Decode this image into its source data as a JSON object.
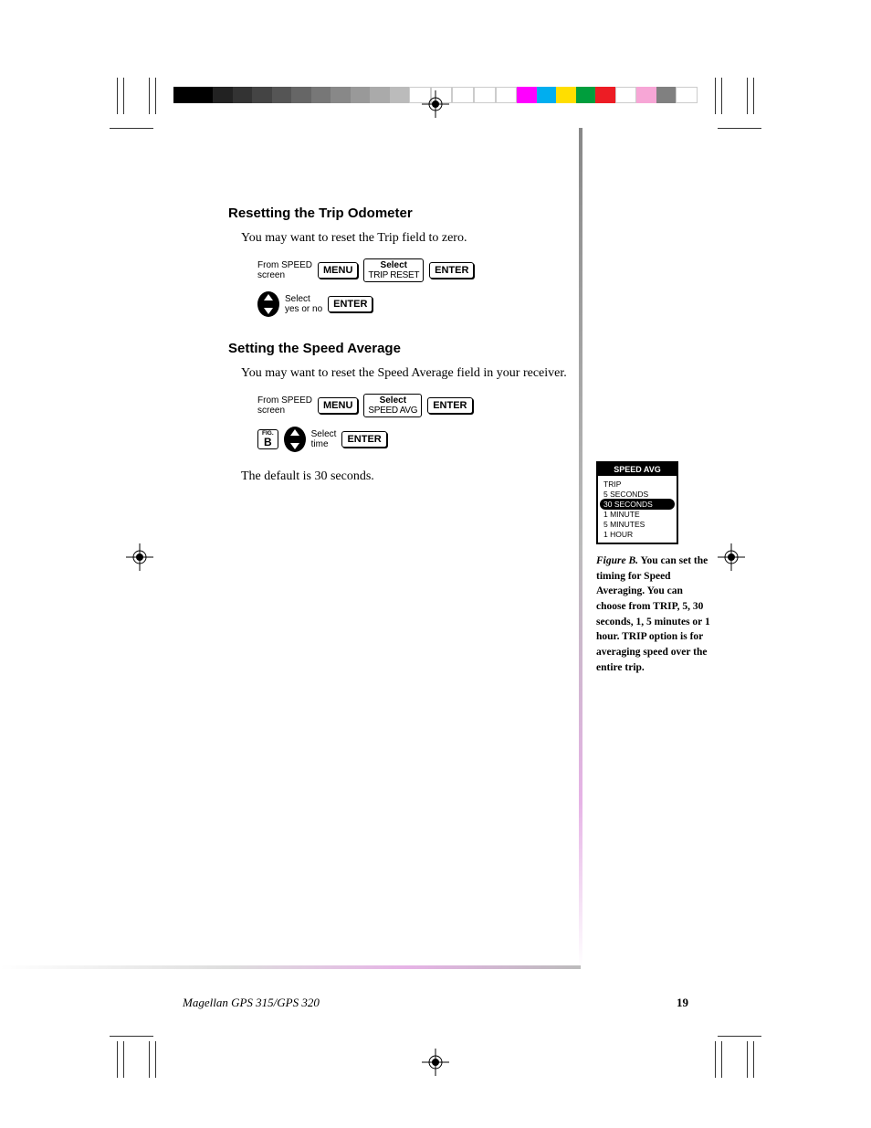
{
  "section1": {
    "heading": "Resetting the Trip Odometer",
    "body": "You may want to reset the Trip field to zero.",
    "seq1": {
      "from": "From SPEED\nscreen",
      "menu": "MENU",
      "select_top": "Select",
      "select_bottom": "TRIP RESET",
      "enter": "ENTER"
    },
    "seq2": {
      "label": "Select\nyes or no",
      "enter": "ENTER"
    }
  },
  "section2": {
    "heading": "Setting the Speed Average",
    "body": "You may want to reset the Speed Average field in your receiver.",
    "seq1": {
      "from": "From SPEED\nscreen",
      "menu": "MENU",
      "select_top": "Select",
      "select_bottom": "SPEED AVG",
      "enter": "ENTER"
    },
    "seq2": {
      "fig_top": "FIG.",
      "fig_letter": "B",
      "label": "Select\ntime",
      "enter": "ENTER"
    },
    "footnote": "The default is 30 seconds."
  },
  "device": {
    "header": "SPEED AVG",
    "items": [
      "TRIP",
      "5 SECONDS",
      "30 SECONDS",
      "1 MINUTE",
      "5 MINUTES",
      "1 HOUR"
    ],
    "selected_index": 2
  },
  "caption": {
    "label": "Figure B.",
    "text": "You can set the timing for Speed Averaging. You can choose from TRIP, 5, 30 seconds, 1, 5 minutes or 1 hour. TRIP option is for averaging speed over the entire trip."
  },
  "footer": {
    "product": "Magellan GPS 315/GPS 320",
    "page": "19"
  },
  "colorbar": [
    "#000",
    "#000",
    "#222",
    "#333",
    "#444",
    "#555",
    "#666",
    "#777",
    "#888",
    "#999",
    "#aaa",
    "#bbb",
    "#fff",
    "#fff",
    "#fff",
    "#fff",
    "#fff",
    "#ff00ff",
    "#00aeef",
    "#ffde00",
    "#009e3d",
    "#ed1c24",
    "#fff",
    "#f7a6d6",
    "#808080",
    "#fff"
  ]
}
